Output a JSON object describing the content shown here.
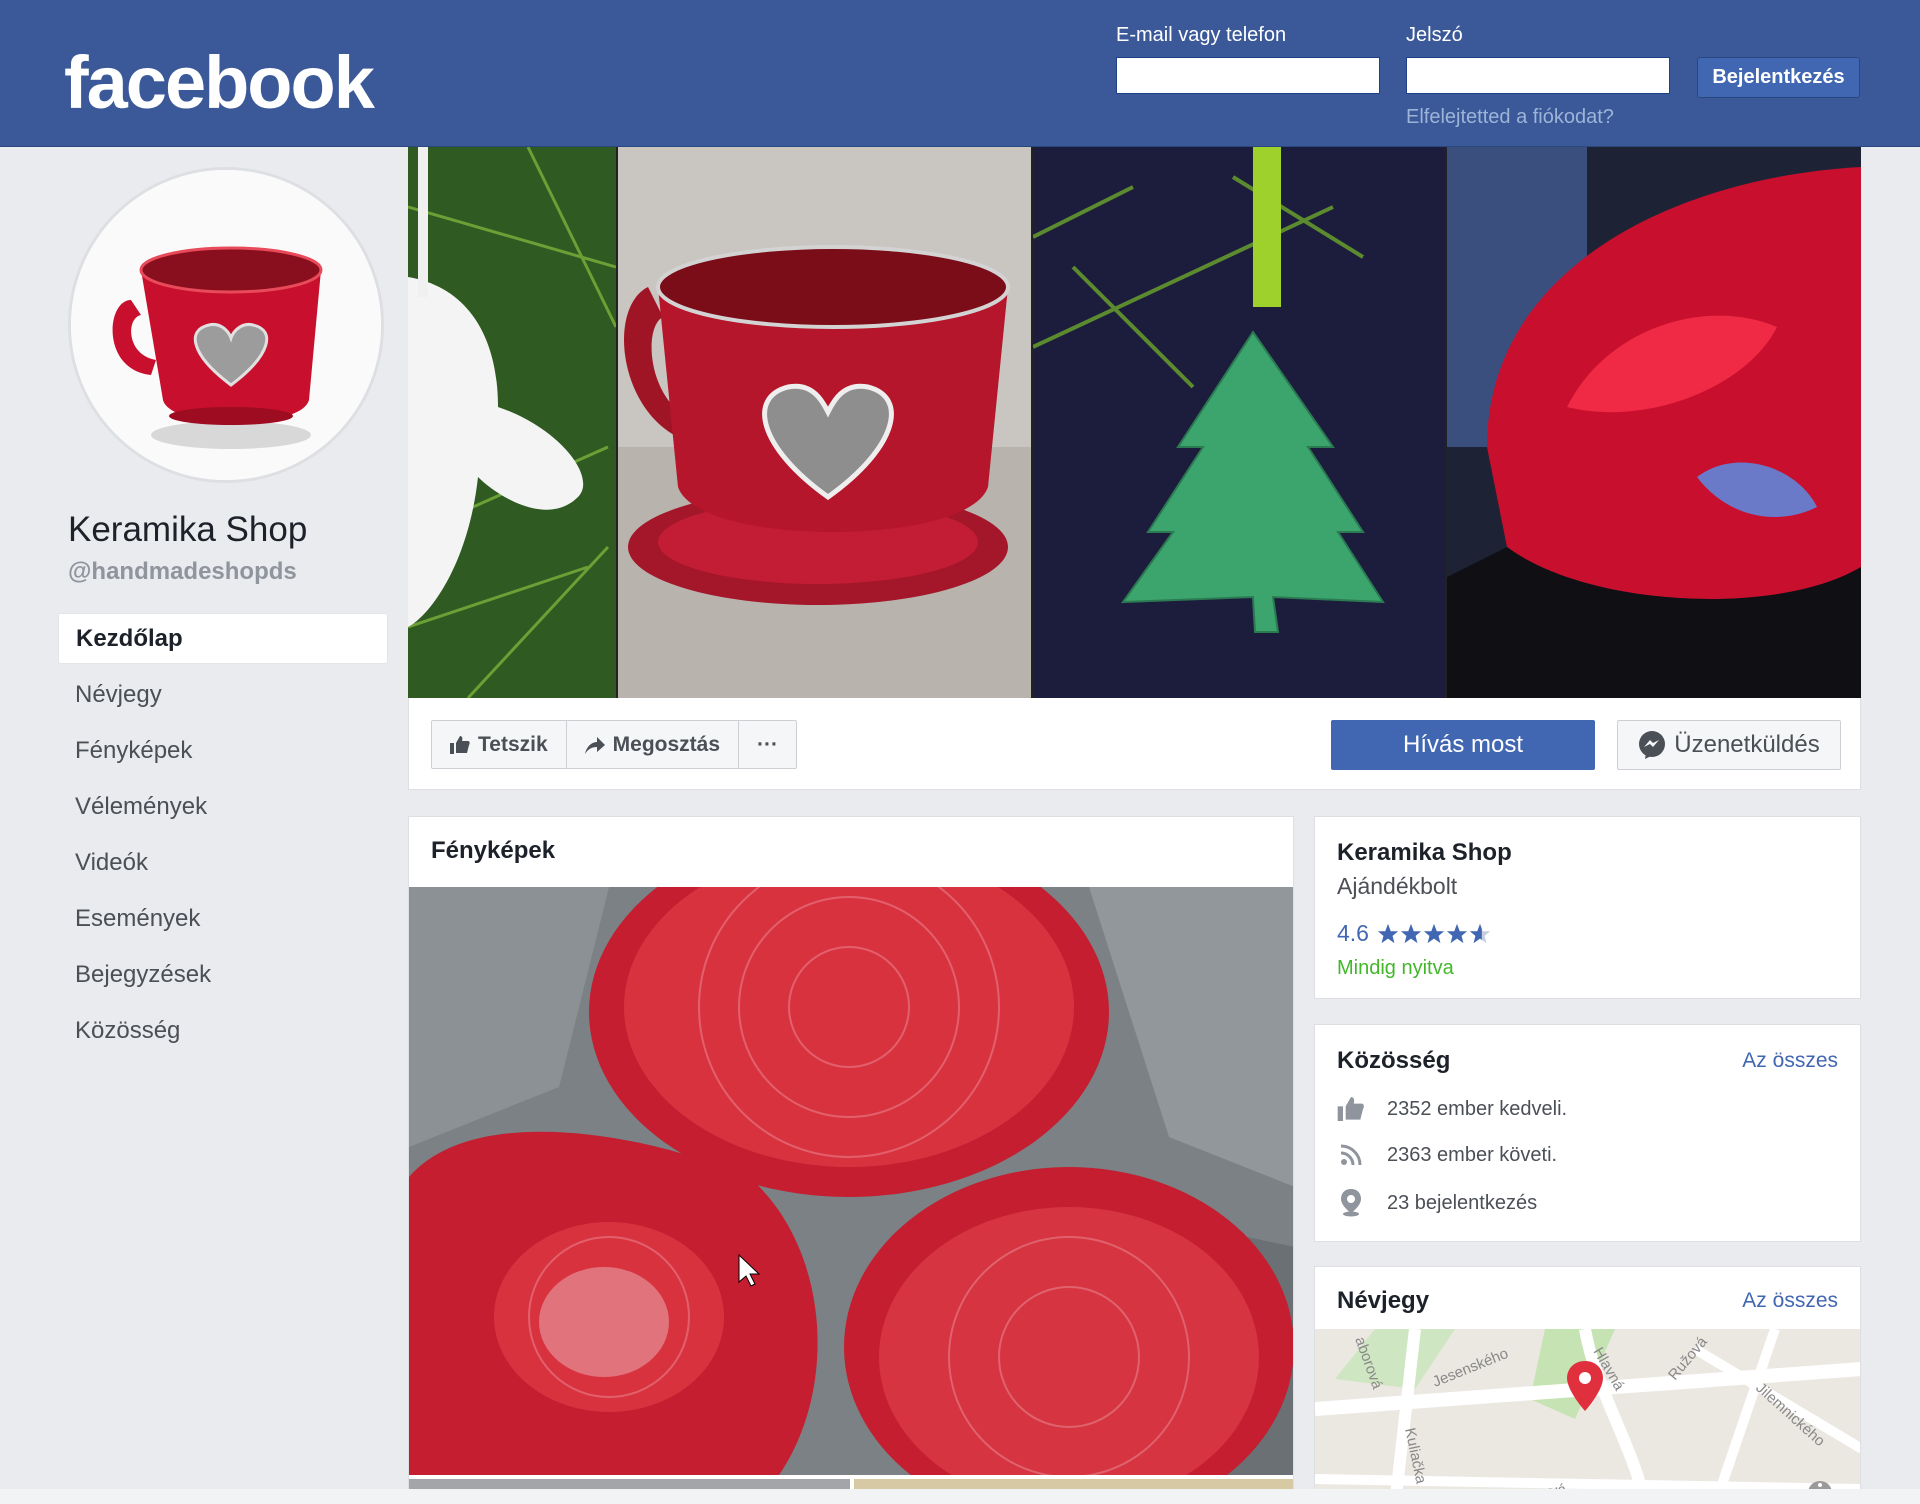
{
  "header": {
    "logo": "facebook",
    "email_label": "E-mail vagy telefon",
    "password_label": "Jelszó",
    "login_button": "Bejelentkezés",
    "forgot_link": "Elfelejtetted a fiókodat?"
  },
  "page": {
    "name": "Keramika Shop",
    "handle": "@handmadeshopds"
  },
  "nav": {
    "items": [
      {
        "label": "Kezdőlap",
        "active": true
      },
      {
        "label": "Névjegy"
      },
      {
        "label": "Fényképek"
      },
      {
        "label": "Vélemények"
      },
      {
        "label": "Videók"
      },
      {
        "label": "Események"
      },
      {
        "label": "Bejegyzések"
      },
      {
        "label": "Közösség"
      }
    ]
  },
  "actions": {
    "like": "Tetszik",
    "share": "Megosztás",
    "more": "···",
    "call": "Hívás most",
    "message": "Üzenetküldés"
  },
  "photos": {
    "title": "Fényképek"
  },
  "info": {
    "name": "Keramika Shop",
    "category": "Ajándékbolt",
    "rating": "4.6",
    "rating_value": 4.6,
    "rating_max": 5,
    "hours": "Mindig nyitva"
  },
  "community": {
    "title": "Közösség",
    "see_all": "Az összes",
    "likes": "2352 ember kedveli.",
    "follows": "2363 ember követi.",
    "checkins": "23 bejelentkezés"
  },
  "about": {
    "title": "Névjegy",
    "see_all": "Az összes",
    "map_labels": [
      "Jesenského",
      "Hlavná",
      "Ružová",
      "Jilemnického",
      "Kuliačka",
      "aborová",
      "Novvá"
    ]
  },
  "colors": {
    "brand": "#3b5998",
    "button": "#4267b2",
    "open": "#42b72a"
  }
}
